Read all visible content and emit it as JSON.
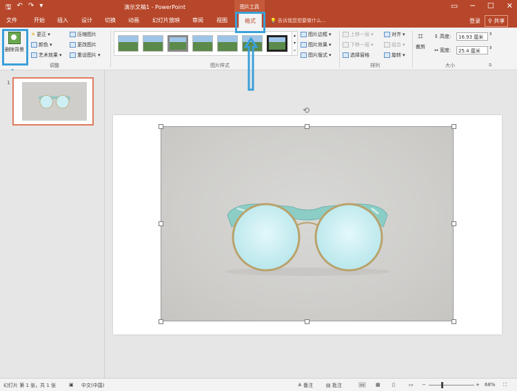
{
  "titlebar": {
    "title": "演示文稿1 - PowerPoint",
    "context_tab": "图片工具",
    "qat": {
      "save": "🖫",
      "undo": "↶",
      "redo": "↷",
      "customize": "▾"
    },
    "win": {
      "ribbon_opts": "▭",
      "minimize": "─",
      "maximize": "☐",
      "close": "✕"
    }
  },
  "tabs": {
    "items": [
      "文件",
      "开始",
      "插入",
      "设计",
      "切换",
      "动画",
      "幻灯片放映",
      "审阅",
      "视图"
    ],
    "active": "格式",
    "tell_me": "告诉我您想要做什么...",
    "sign_in": "登录",
    "share": "共享"
  },
  "ribbon": {
    "adjust": {
      "label": "调整",
      "remove_bg": "删除背景",
      "corrections": "更正",
      "color": "颜色",
      "artistic": "艺术效果",
      "compress": "压缩图片",
      "change": "更改图片",
      "reset": "重设图片"
    },
    "styles": {
      "label": "图片样式",
      "border": "图片边框",
      "effects": "图片效果",
      "layout": "图片版式"
    },
    "arrange": {
      "label": "排列",
      "bring_forward": "上移一层",
      "send_backward": "下移一层",
      "selection_pane": "选择窗格",
      "align": "对齐",
      "group": "组合",
      "rotate": "旋转"
    },
    "size": {
      "label": "大小",
      "crop": "裁剪",
      "height_label": "高度:",
      "height_value": "16.93 厘米",
      "width_label": "宽度:",
      "width_value": "25.4 厘米"
    }
  },
  "slides_pane": {
    "slide_number": "1"
  },
  "statusbar": {
    "slide_info": "幻灯片 第 1 张，共 1 张",
    "language": "中文(中国)",
    "notes": "备注",
    "comments": "批注",
    "zoom": "68%"
  }
}
